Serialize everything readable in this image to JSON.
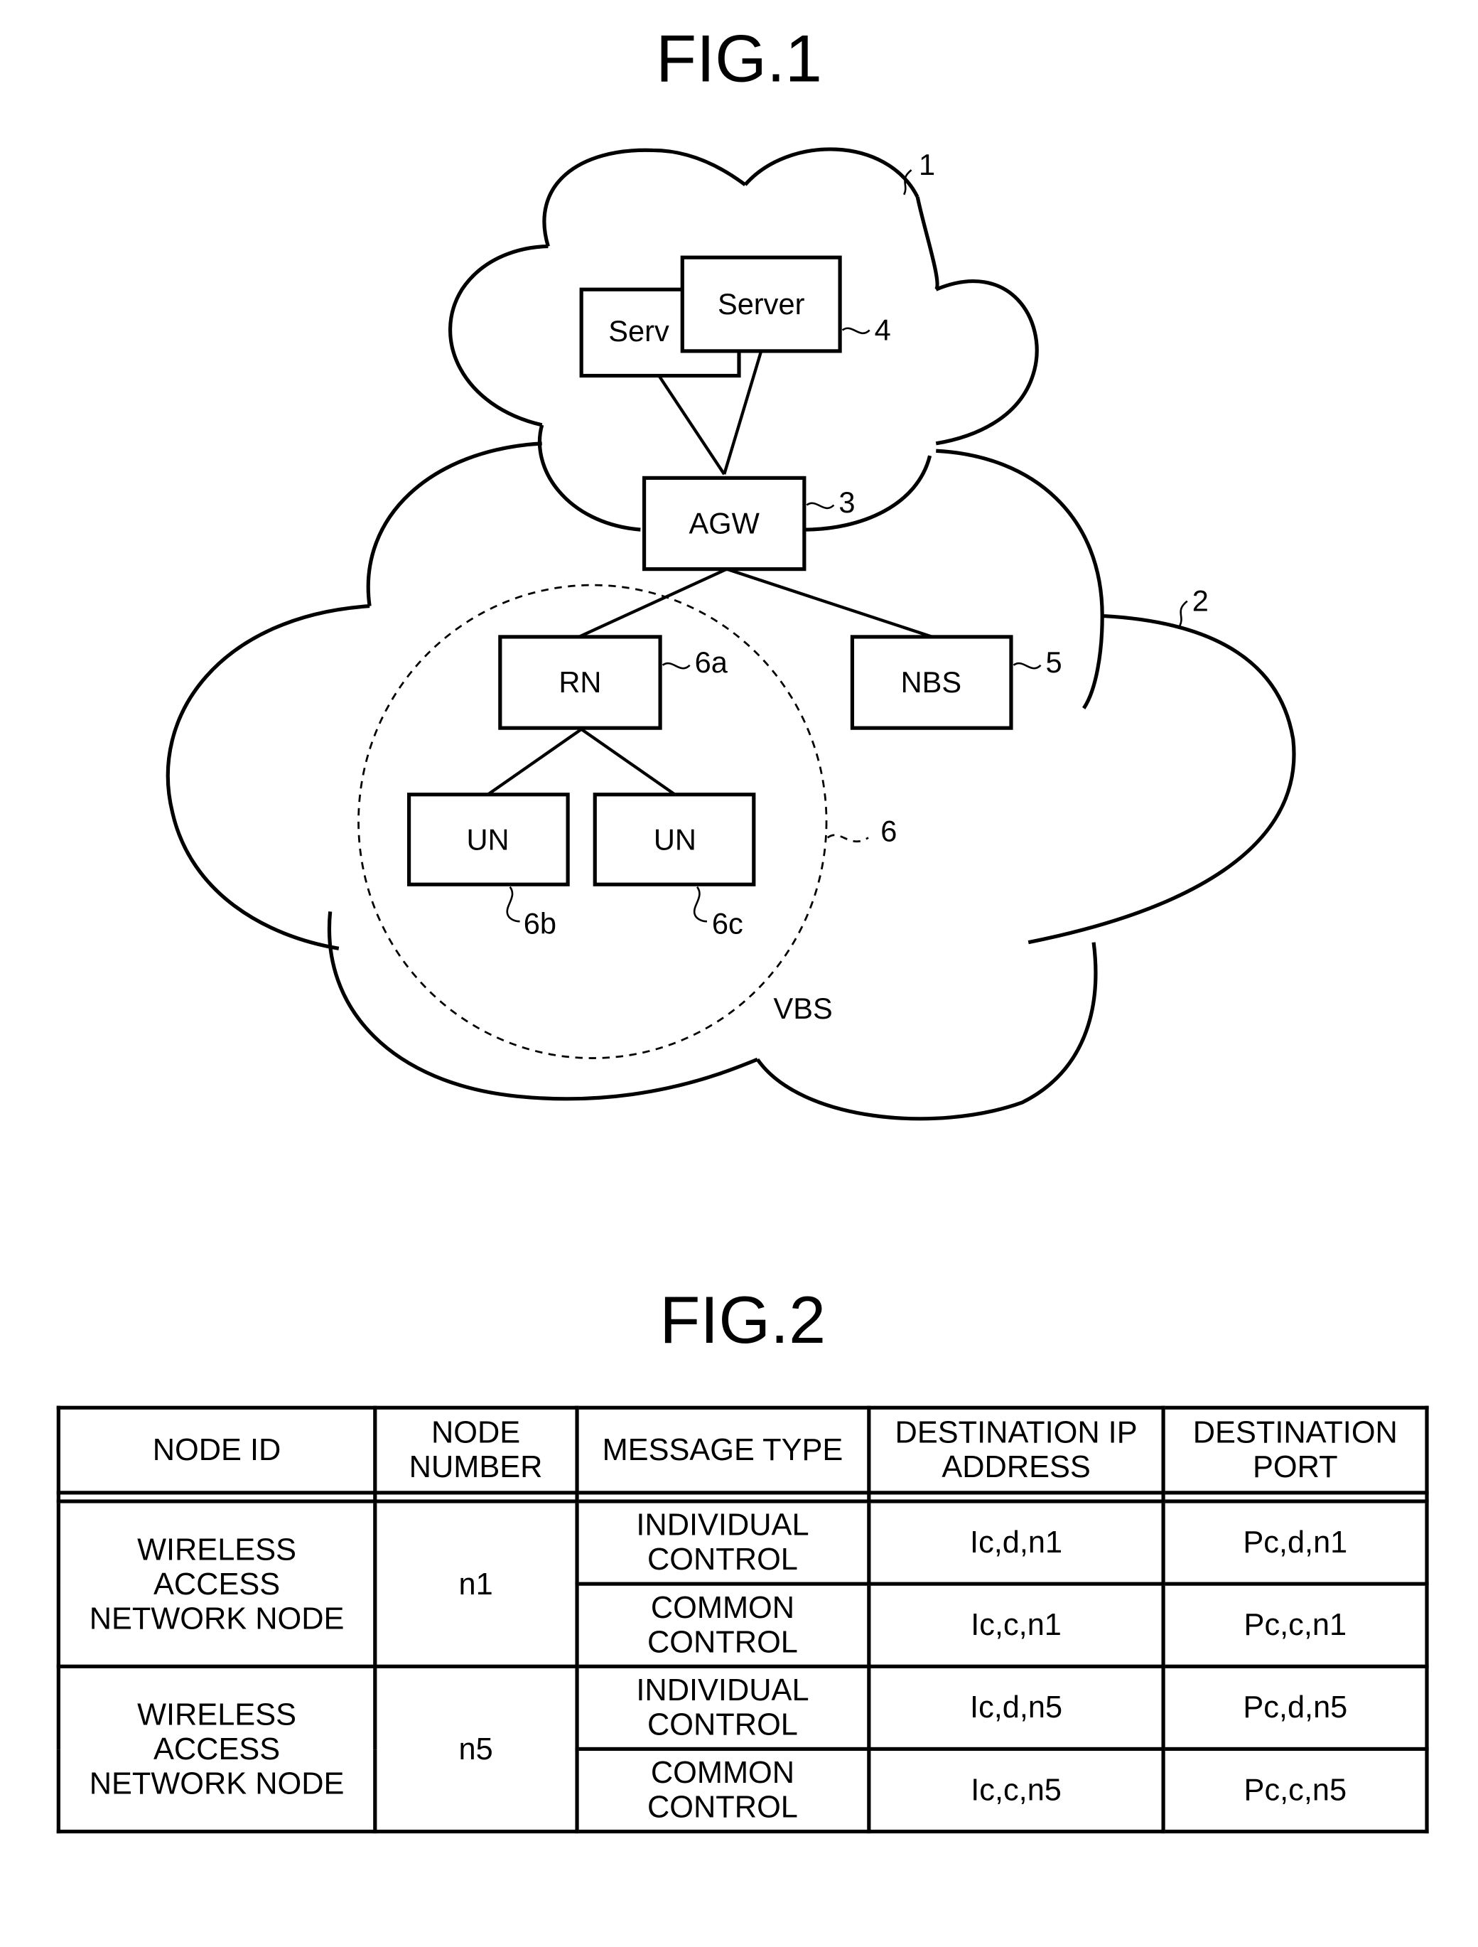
{
  "fig1": {
    "title": "FIG.1",
    "nodes": {
      "server_back": "Serv",
      "server_front": "Server",
      "agw": "AGW",
      "rn": "RN",
      "nbs": "NBS",
      "un_left": "UN",
      "un_right": "UN"
    },
    "refs": {
      "cloud_top": "1",
      "cloud_main": "2",
      "agw": "3",
      "server": "4",
      "nbs": "5",
      "vbs_area": "6",
      "rn": "6a",
      "un_left": "6b",
      "un_right": "6c"
    },
    "vbs_label": "VBS"
  },
  "fig2": {
    "title": "FIG.2",
    "headers": {
      "node_id": "NODE ID",
      "node_number_1": "NODE",
      "node_number_2": "NUMBER",
      "message_type": "MESSAGE TYPE",
      "dest_ip_1": "DESTINATION IP",
      "dest_ip_2": "ADDRESS",
      "dest_port_1": "DESTINATION",
      "dest_port_2": "PORT"
    },
    "groups": [
      {
        "node_id_lines": [
          "WIRELESS",
          "ACCESS",
          "NETWORK NODE"
        ],
        "node_number": "n1",
        "rows": [
          {
            "type_lines": [
              "INDIVIDUAL",
              "CONTROL"
            ],
            "ip": "Ic,d,n1",
            "port": "Pc,d,n1"
          },
          {
            "type_lines": [
              "COMMON",
              "CONTROL"
            ],
            "ip": "Ic,c,n1",
            "port": "Pc,c,n1"
          }
        ]
      },
      {
        "node_id_lines": [
          "WIRELESS",
          "ACCESS",
          "NETWORK NODE"
        ],
        "node_number": "n5",
        "rows": [
          {
            "type_lines": [
              "INDIVIDUAL",
              "CONTROL"
            ],
            "ip": "Ic,d,n5",
            "port": "Pc,d,n5"
          },
          {
            "type_lines": [
              "COMMON",
              "CONTROL"
            ],
            "ip": "Ic,c,n5",
            "port": "Pc,c,n5"
          }
        ]
      }
    ]
  }
}
